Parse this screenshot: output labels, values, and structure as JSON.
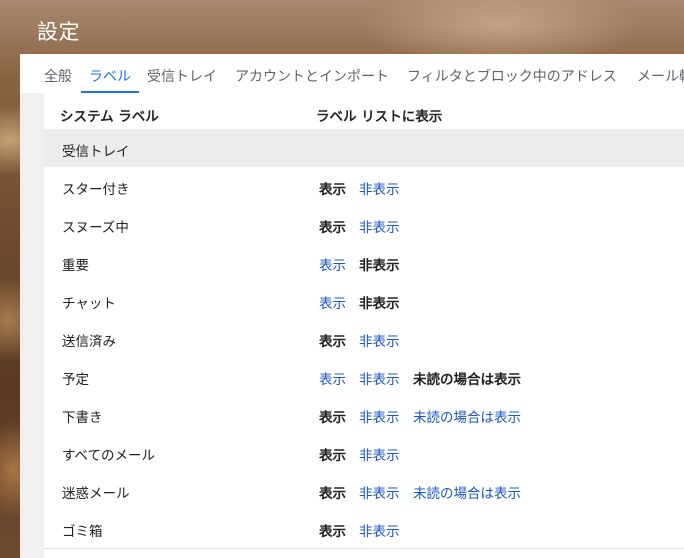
{
  "header": {
    "title": "設定"
  },
  "tabs": [
    {
      "label": "全般"
    },
    {
      "label": "ラベル",
      "active": true
    },
    {
      "label": "受信トレイ"
    },
    {
      "label": "アカウントとインポート"
    },
    {
      "label": "フィルタとブロック中のアドレス"
    },
    {
      "label": "メール転"
    }
  ],
  "columns": {
    "system_labels": "システム ラベル",
    "show_in_list": "ラベル リストに表示"
  },
  "options": {
    "show": "表示",
    "hide": "非表示",
    "show_if_unread": "未読の場合は表示"
  },
  "rows": [
    {
      "name": "受信トレイ",
      "selected": null
    },
    {
      "name": "スター付き",
      "selected": "show"
    },
    {
      "name": "スヌーズ中",
      "selected": "show"
    },
    {
      "name": "重要",
      "selected": "hide"
    },
    {
      "name": "チャット",
      "selected": "hide"
    },
    {
      "name": "送信済み",
      "selected": "show"
    },
    {
      "name": "予定",
      "selected": "show_if_unread"
    },
    {
      "name": "下書き",
      "selected": "show"
    },
    {
      "name": "すべてのメール",
      "selected": "show"
    },
    {
      "name": "迷惑メール",
      "selected": "show"
    },
    {
      "name": "ゴミ箱",
      "selected": "show"
    }
  ],
  "colors": {
    "accent": "#1a73e8",
    "link": "#1a56c7",
    "text": "#202124"
  }
}
